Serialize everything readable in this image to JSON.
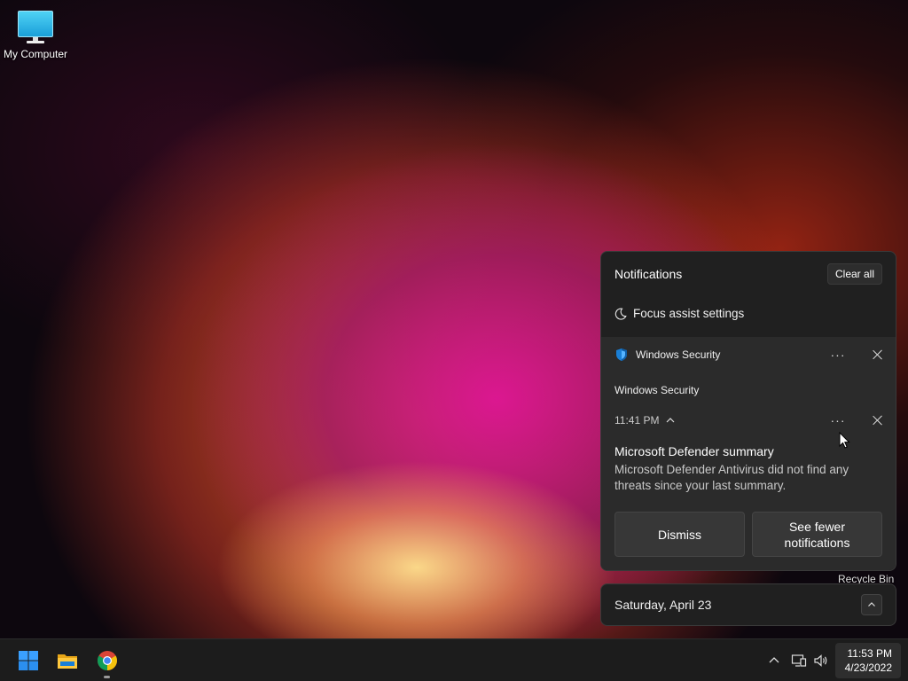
{
  "desktop": {
    "icons": [
      {
        "label": "My Computer",
        "icon": "monitor-icon"
      },
      {
        "label": "Recycle Bin",
        "icon": "recycle-bin-icon"
      }
    ]
  },
  "notifications": {
    "title": "Notifications",
    "clear_all_label": "Clear all",
    "focus_assist_label": "Focus assist settings",
    "focus_assist_icon": "moon-icon",
    "app_name": "Windows Security",
    "app_icon": "shield-icon",
    "group_title": "Windows Security",
    "time": "11:41 PM",
    "toast": {
      "title": "Microsoft Defender summary",
      "body": "Microsoft Defender Antivirus did not find any threats since your last summary."
    },
    "actions": {
      "dismiss": "Dismiss",
      "see_fewer": "See fewer notifications"
    }
  },
  "calendar": {
    "date_label": "Saturday, April 23"
  },
  "taskbar": {
    "pinned": [
      "start-icon",
      "file-explorer-icon",
      "chrome-icon"
    ],
    "tray": [
      "chevron-up-icon",
      "network-icon",
      "volume-icon"
    ],
    "clock_time": "11:53 PM",
    "clock_date": "4/23/2022"
  },
  "colors": {
    "panel_bg": "#202020",
    "card_bg": "#2b2b2b",
    "button_bg": "#373737",
    "taskbar_bg": "#1c1c1c",
    "windows_accent": "#1e90ff"
  }
}
